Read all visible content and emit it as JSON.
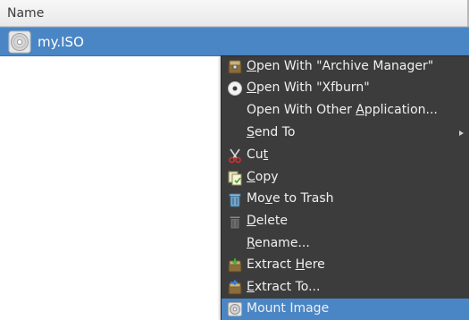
{
  "header": {
    "column_name": "Name"
  },
  "file": {
    "name": "my.ISO",
    "icon": "disc-image-icon"
  },
  "context_menu": {
    "items": [
      {
        "label_pre": "",
        "label_key": "O",
        "label_post": "pen With \"Archive Manager\"",
        "icon": "archive-manager-icon"
      },
      {
        "label_pre": "",
        "label_key": "O",
        "label_post": "pen With \"Xfburn\"",
        "icon": "xfburn-disc-icon"
      },
      {
        "label_pre": "Open With Other ",
        "label_key": "A",
        "label_post": "pplication...",
        "icon": ""
      },
      {
        "label_pre": "",
        "label_key": "S",
        "label_post": "end To",
        "icon": "",
        "submenu": true
      },
      {
        "label_pre": "Cu",
        "label_key": "t",
        "label_post": "",
        "icon": "scissors-icon"
      },
      {
        "label_pre": "",
        "label_key": "C",
        "label_post": "opy",
        "icon": "copy-icon"
      },
      {
        "label_pre": "Mo",
        "label_key": "v",
        "label_post": "e to Trash",
        "icon": "trash-icon"
      },
      {
        "label_pre": "",
        "label_key": "D",
        "label_post": "elete",
        "icon": "delete-icon"
      },
      {
        "label_pre": "",
        "label_key": "R",
        "label_post": "ename...",
        "icon": ""
      },
      {
        "label_pre": "Extract ",
        "label_key": "H",
        "label_post": "ere",
        "icon": "extract-here-icon"
      },
      {
        "label_pre": "",
        "label_key": "E",
        "label_post": "xtract To...",
        "icon": "extract-to-icon"
      },
      {
        "label_pre": "Mount Image",
        "label_key": "",
        "label_post": "",
        "icon": "mount-image-icon",
        "highlighted": true
      }
    ]
  },
  "colors": {
    "selection": "#4a86c5",
    "menu_bg": "#3c3c3c",
    "menu_text": "#f0f0f0"
  }
}
